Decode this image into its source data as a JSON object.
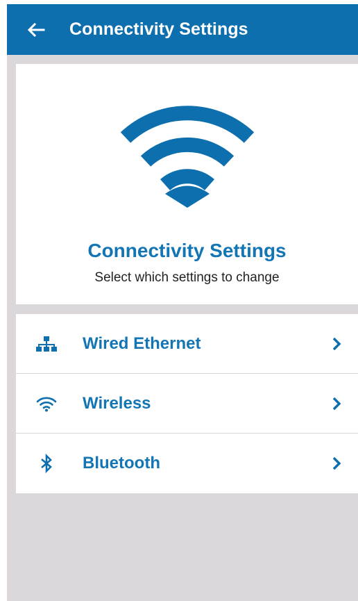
{
  "appbar": {
    "title": "Connectivity Settings",
    "back_icon": "arrow-left-icon"
  },
  "hero": {
    "icon": "wifi-icon",
    "title": "Connectivity Settings",
    "subtitle": "Select which settings to change"
  },
  "menu": {
    "items": [
      {
        "label": "Wired Ethernet",
        "icon": "network-icon"
      },
      {
        "label": "Wireless",
        "icon": "wifi-icon"
      },
      {
        "label": "Bluetooth",
        "icon": "bluetooth-icon"
      }
    ]
  },
  "colors": {
    "primary": "#0d6fae",
    "accent_text": "#1475b5",
    "background": "#dbd7db",
    "surface": "#ffffff"
  }
}
